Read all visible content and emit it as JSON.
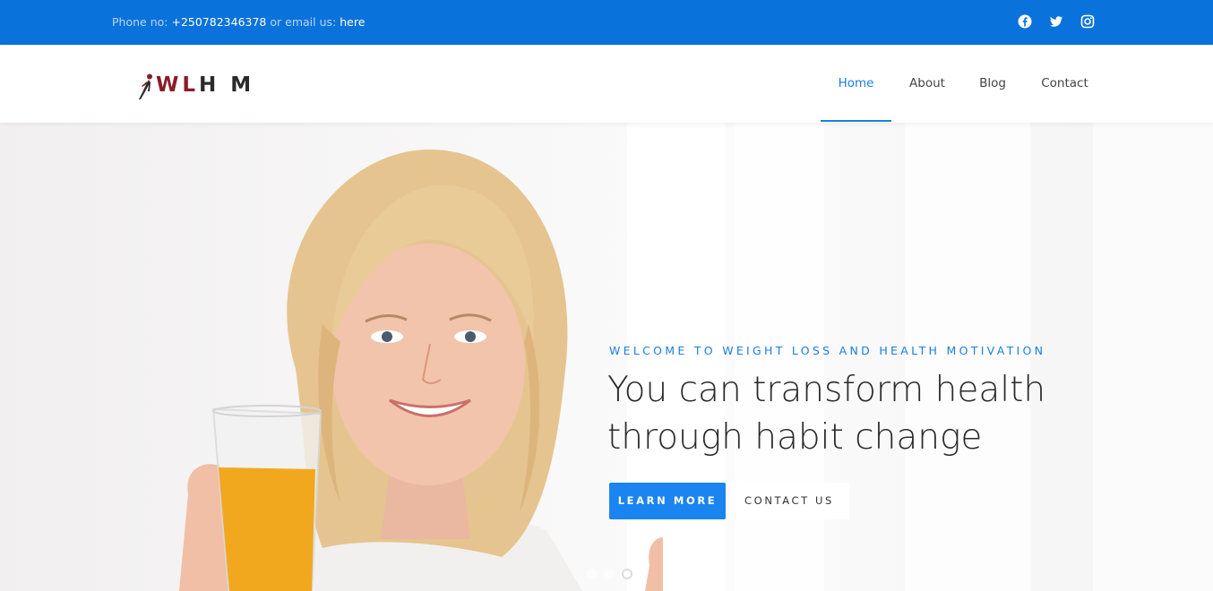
{
  "topbar": {
    "phone_label": "Phone no:",
    "phone_number": "+250782346378",
    "email_label": "or email us:",
    "email_link": "here",
    "social": [
      "facebook-icon",
      "twitter-icon",
      "instagram-icon"
    ]
  },
  "logo": {
    "w": "W",
    "l": "L",
    "hm": "H M"
  },
  "nav": {
    "items": [
      {
        "label": "Home",
        "active": true
      },
      {
        "label": "About",
        "active": false
      },
      {
        "label": "Blog",
        "active": false
      },
      {
        "label": "Contact",
        "active": false
      }
    ]
  },
  "hero": {
    "kicker": "WELCOME TO WEIGHT LOSS AND HEALTH MOTIVATION",
    "headline_line1": "You can transform health",
    "headline_line2": "through habit change",
    "learn_more": "LEARN MORE",
    "contact_us": "CONTACT US",
    "slides": 3,
    "active_slide": 3
  },
  "colors": {
    "topbar": "#0a72db",
    "accent": "#1a7fe0",
    "logo_red": "#8a1d27"
  }
}
